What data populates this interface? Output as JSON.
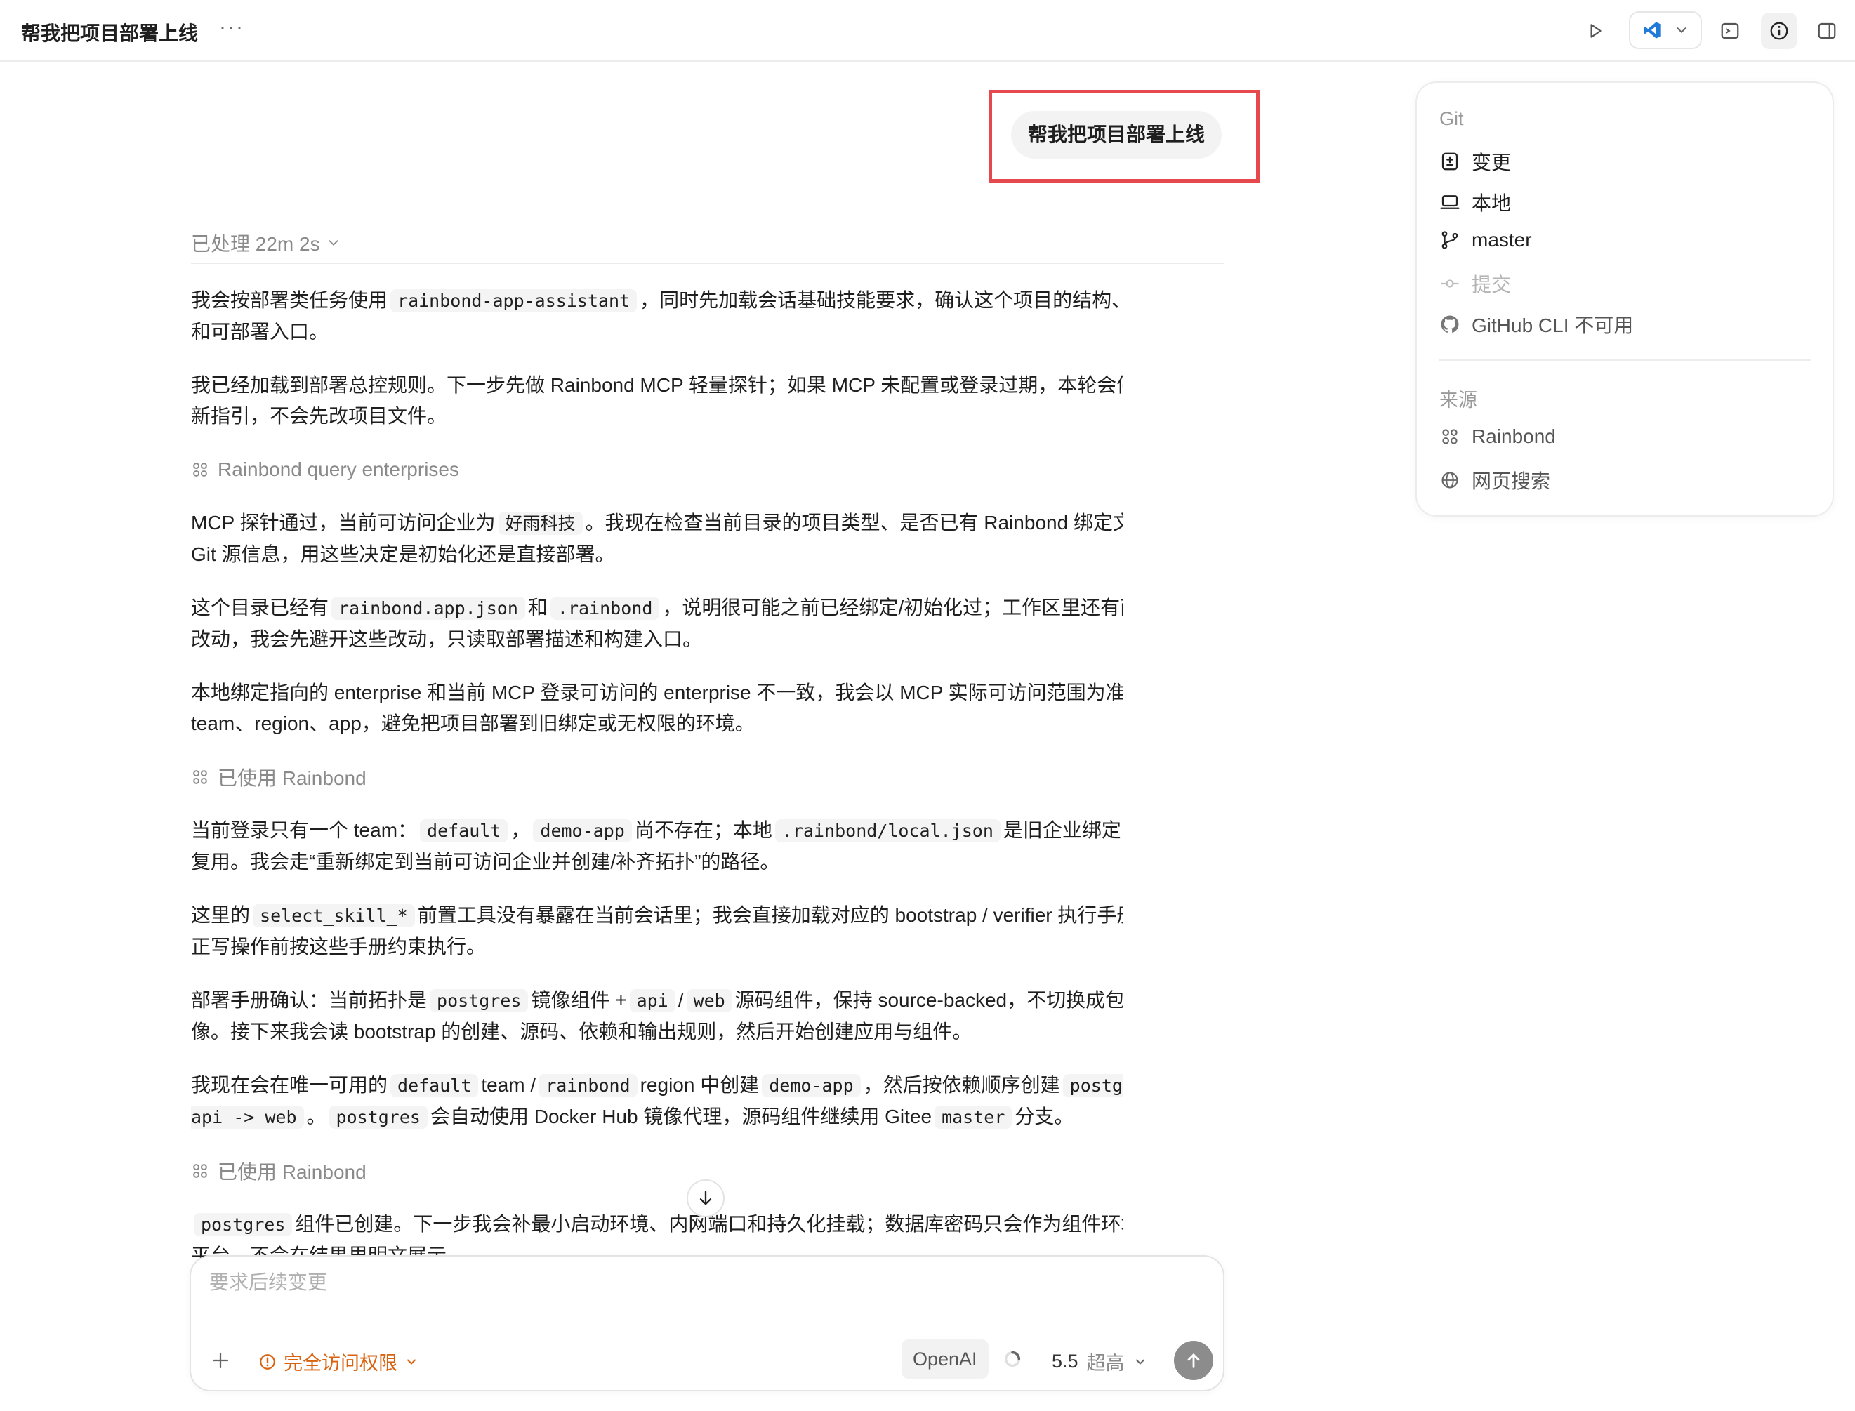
{
  "window": {
    "title": "帮我把项目部署上线",
    "more_label": "···"
  },
  "user_message": "帮我把项目部署上线",
  "processed_label": "已处理 22m 2s",
  "thread": {
    "p1": {
      "a": "我会按部署类任务使用",
      "code1": "rainbond-app-assistant",
      "b": "，同时先加载会话基础技能要求，确认这个项目的结构、运行方式和可部署入口。"
    },
    "p2": "我已经加载到部署总控规则。下一步先做 Rainbond MCP 轻量探针；如果 MCP 未配置或登录过期，本轮会停在配置/刷新指引，不会先改项目文件。",
    "tool1": "Rainbond query enterprises",
    "p3": {
      "a": "MCP 探针通过，当前可访问企业为",
      "code1": "好雨科技",
      "b": "。我现在检查当前目录的项目类型、是否已有 Rainbond 绑定文件，以及 Git 源信息，用这些决定是初始化还是直接部署。"
    },
    "p4": {
      "a": "这个目录已经有",
      "code1": "rainbond.app.json",
      "b": "和",
      "code2": ".rainbond",
      "c": "，说明很可能之前已经绑定/初始化过；工作区里还有两处未提交改动，我会先避开这些改动，只读取部署描述和构建入口。"
    },
    "p5": "本地绑定指向的 enterprise 和当前 MCP 登录可访问的 enterprise 不一致，我会以 MCP 实际可访问范围为准核对 team、region、app，避免把项目部署到旧绑定或无权限的环境。",
    "tool2": "已使用 Rainbond",
    "p6": {
      "a": "当前登录只有一个 team：",
      "code1": "default",
      "b": "，",
      "code2": "demo-app",
      "c": "尚不存在；本地",
      "code3": ".rainbond/local.json",
      "d": "是旧企业绑定，不能直接复用。我会走“重新绑定到当前可访问企业并创建/补齐拓扑”的路径。"
    },
    "p7": {
      "a": "这里的",
      "code1": "select_skill_*",
      "b": "前置工具没有暴露在当前会话里；我会直接加载对应的 bootstrap / verifier 执行手册，并在真正写操作前按这些手册约束执行。"
    },
    "p8": {
      "a": "部署手册确认：当前拓扑是",
      "code1": "postgres",
      "b": "镜像组件 +",
      "code2": "api",
      "c": "/",
      "code3": "web",
      "d": "源码组件，保持 source-backed，不切换成包或临时镜像。接下来我会读 bootstrap 的创建、源码、依赖和输出规则，然后开始创建应用与组件。"
    },
    "p9": {
      "a": "我现在会在唯一可用的",
      "code1": "default",
      "b": "team /",
      "code2": "rainbond",
      "c": "region 中创建",
      "code3": "demo-app",
      "d": "，然后按依赖顺序创建",
      "code4": "postgres -> api -> web",
      "e": "。",
      "code5": "postgres",
      "f": "会自动使用 Docker Hub 镜像代理，源码组件继续用 Gitee",
      "code6": "master",
      "g": "分支。"
    },
    "tool3": "已使用 Rainbond",
    "p10": {
      "code1": "postgres",
      "a": "组件已创建。下一步我会补最小启动环境、内网端口和持久化挂载；数据库密码只会作为组件环境变量写入平台，不会在结果里明文展示。"
    }
  },
  "composer": {
    "placeholder": "要求后续变更",
    "access_label": "完全访问权限",
    "provider": "OpenAI",
    "model": "5.5",
    "effort": "超高"
  },
  "sidebar": {
    "git_heading": "Git",
    "items": [
      {
        "label": "变更",
        "icon": "diff-icon"
      },
      {
        "label": "本地",
        "icon": "laptop-icon"
      },
      {
        "label": "master",
        "icon": "branch-icon"
      },
      {
        "label": "提交",
        "icon": "commit-icon"
      },
      {
        "label": "GitHub CLI 不可用",
        "icon": "github-icon"
      }
    ],
    "source_heading": "来源",
    "sources": [
      {
        "label": "Rainbond",
        "icon": "rainbond-icon"
      },
      {
        "label": "网页搜索",
        "icon": "globe-icon"
      }
    ]
  },
  "colors": {
    "highlight_border": "#e5484d",
    "access_orange": "#d9620f",
    "vscode_blue": "#1f7ad8"
  }
}
